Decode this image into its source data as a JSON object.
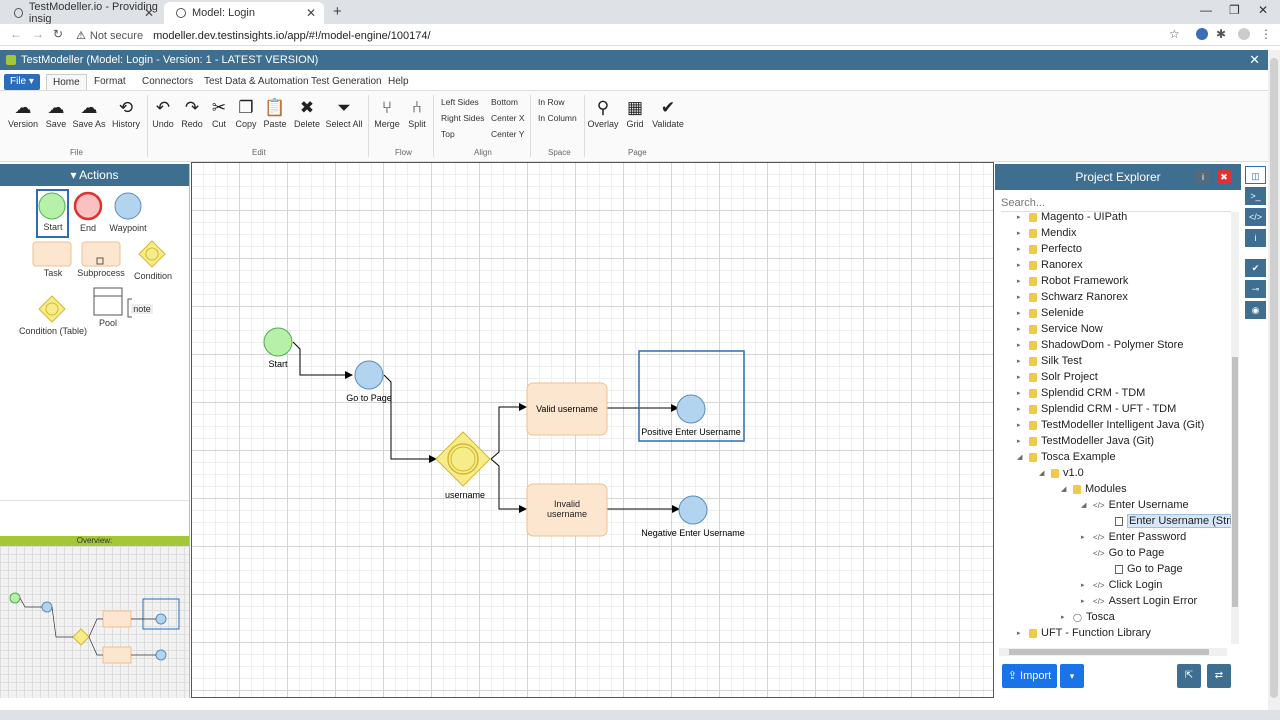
{
  "browser": {
    "tabs": [
      {
        "title": "TestModeller.io - Providing insig"
      },
      {
        "title": "Model: Login"
      }
    ],
    "url": "modeller.dev.testinsights.io/app/#!/model-engine/100174/",
    "security": "Not secure"
  },
  "app": {
    "title": "TestModeller (Model: Login - Version: 1 - LATEST VERSION)"
  },
  "menu": [
    "File",
    "Home",
    "Format",
    "Connectors",
    "Test Data & Automation",
    "Test Generation",
    "Help"
  ],
  "ribbon": {
    "file": [
      "Version",
      "Save",
      "Save As",
      "History"
    ],
    "edit": [
      "Undo",
      "Redo",
      "Cut",
      "Copy",
      "Paste",
      "Delete",
      "Select All"
    ],
    "flow": [
      "Merge",
      "Split"
    ],
    "align": [
      "Left Sides",
      "Right Sides",
      "Top",
      "Bottom",
      "Center X",
      "Center Y"
    ],
    "space": [
      "In Row",
      "In Column"
    ],
    "page": [
      "Overlay",
      "Grid",
      "Validate"
    ],
    "groups": [
      "File",
      "Edit",
      "Flow",
      "Align",
      "Space",
      "Page"
    ]
  },
  "actions": {
    "title": "Actions",
    "shapes": [
      "Start",
      "End",
      "Waypoint",
      "Task",
      "Subprocess",
      "Condition",
      "Condition (Table)",
      "Pool",
      "note"
    ],
    "overview": "Overview:"
  },
  "diagram": {
    "nodes": [
      "Start",
      "Go to Page",
      "username",
      "Valid username",
      "Invalid username",
      "Positive Enter Username",
      "Negative Enter Username"
    ]
  },
  "explorer": {
    "title": "Project Explorer",
    "search_placeholder": "Search...",
    "tree": [
      "Magento - UIPath",
      "Mendix",
      "Perfecto",
      "Ranorex",
      "Robot Framework",
      "Schwarz Ranorex",
      "Selenide",
      "Service Now",
      "ShadowDom - Polymer Store",
      "Silk Test",
      "Solr Project",
      "Splendid CRM - TDM",
      "Splendid CRM - UFT - TDM",
      "TestModeller Intelligent Java (Git)",
      "TestModeller Java (Git)",
      "Tosca Example",
      "v1.0",
      "Modules",
      "Enter Username",
      "Enter Username (Strin",
      "Enter Password",
      "Go to Page",
      "Go to Page",
      "Click Login",
      "Assert Login Error",
      "Tosca",
      "UFT - Function Library"
    ],
    "import_label": "Import"
  }
}
